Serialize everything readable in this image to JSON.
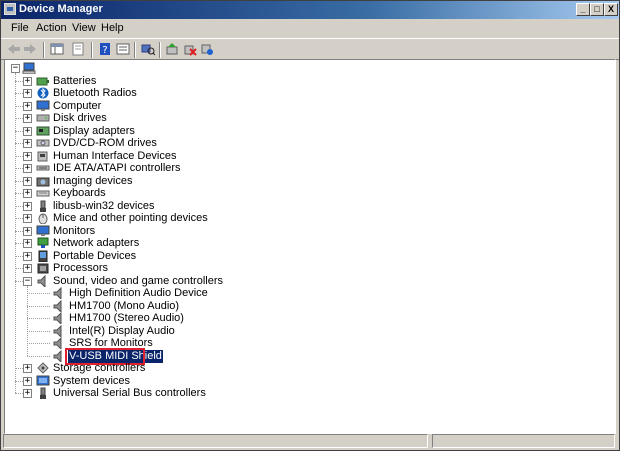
{
  "window": {
    "title": "Device Manager"
  },
  "title_buttons": {
    "minimize": "_",
    "maximize": "□",
    "close": "X"
  },
  "menu": [
    "File",
    "Action",
    "View",
    "Help"
  ],
  "toolbar_icons": [
    "back-icon",
    "forward-icon",
    "show-hide-console-tree-icon",
    "properties-icon",
    "help-icon",
    "export-list-icon",
    "scan-hardware-icon",
    "update-driver-icon",
    "uninstall-icon",
    "enable-device-icon"
  ],
  "tree": {
    "root_icon": "computer-icon",
    "categories": [
      {
        "label": "Batteries",
        "icon": "battery-icon"
      },
      {
        "label": "Bluetooth Radios",
        "icon": "bluetooth-icon"
      },
      {
        "label": "Computer",
        "icon": "monitor-icon"
      },
      {
        "label": "Disk drives",
        "icon": "disk-icon"
      },
      {
        "label": "Display adapters",
        "icon": "display-adapter-icon"
      },
      {
        "label": "DVD/CD-ROM drives",
        "icon": "dvd-icon"
      },
      {
        "label": "Human Interface Devices",
        "icon": "hid-icon"
      },
      {
        "label": "IDE ATA/ATAPI controllers",
        "icon": "ide-icon"
      },
      {
        "label": "Imaging devices",
        "icon": "camera-icon"
      },
      {
        "label": "Keyboards",
        "icon": "keyboard-icon"
      },
      {
        "label": "libusb-win32 devices",
        "icon": "usb-icon"
      },
      {
        "label": "Mice and other pointing devices",
        "icon": "mouse-icon"
      },
      {
        "label": "Monitors",
        "icon": "monitor-icon"
      },
      {
        "label": "Network adapters",
        "icon": "network-icon"
      },
      {
        "label": "Portable Devices",
        "icon": "portable-device-icon"
      },
      {
        "label": "Processors",
        "icon": "processor-icon"
      },
      {
        "label": "Sound, video and game controllers",
        "icon": "speaker-icon",
        "expanded": true
      }
    ],
    "sound_children": [
      {
        "label": "High Definition Audio Device",
        "icon": "speaker-icon"
      },
      {
        "label": "HM1700 (Mono Audio)",
        "icon": "speaker-icon"
      },
      {
        "label": "HM1700 (Stereo Audio)",
        "icon": "speaker-icon"
      },
      {
        "label": "Intel(R) Display Audio",
        "icon": "speaker-icon"
      },
      {
        "label": "SRS for Monitors",
        "icon": "speaker-icon"
      },
      {
        "label": "V-USB MIDI Shield",
        "icon": "speaker-icon",
        "selected": true
      }
    ],
    "after": [
      {
        "label": "Storage controllers",
        "icon": "storage-icon"
      },
      {
        "label": "System devices",
        "icon": "system-icon"
      },
      {
        "label": "Universal Serial Bus controllers",
        "icon": "usb-icon"
      }
    ],
    "expand_glyph": "+",
    "collapse_glyph": "−"
  },
  "colors": {
    "selection": "#0a246a",
    "highlight_box": "#e0202e",
    "titlebar": "#0a246a"
  }
}
